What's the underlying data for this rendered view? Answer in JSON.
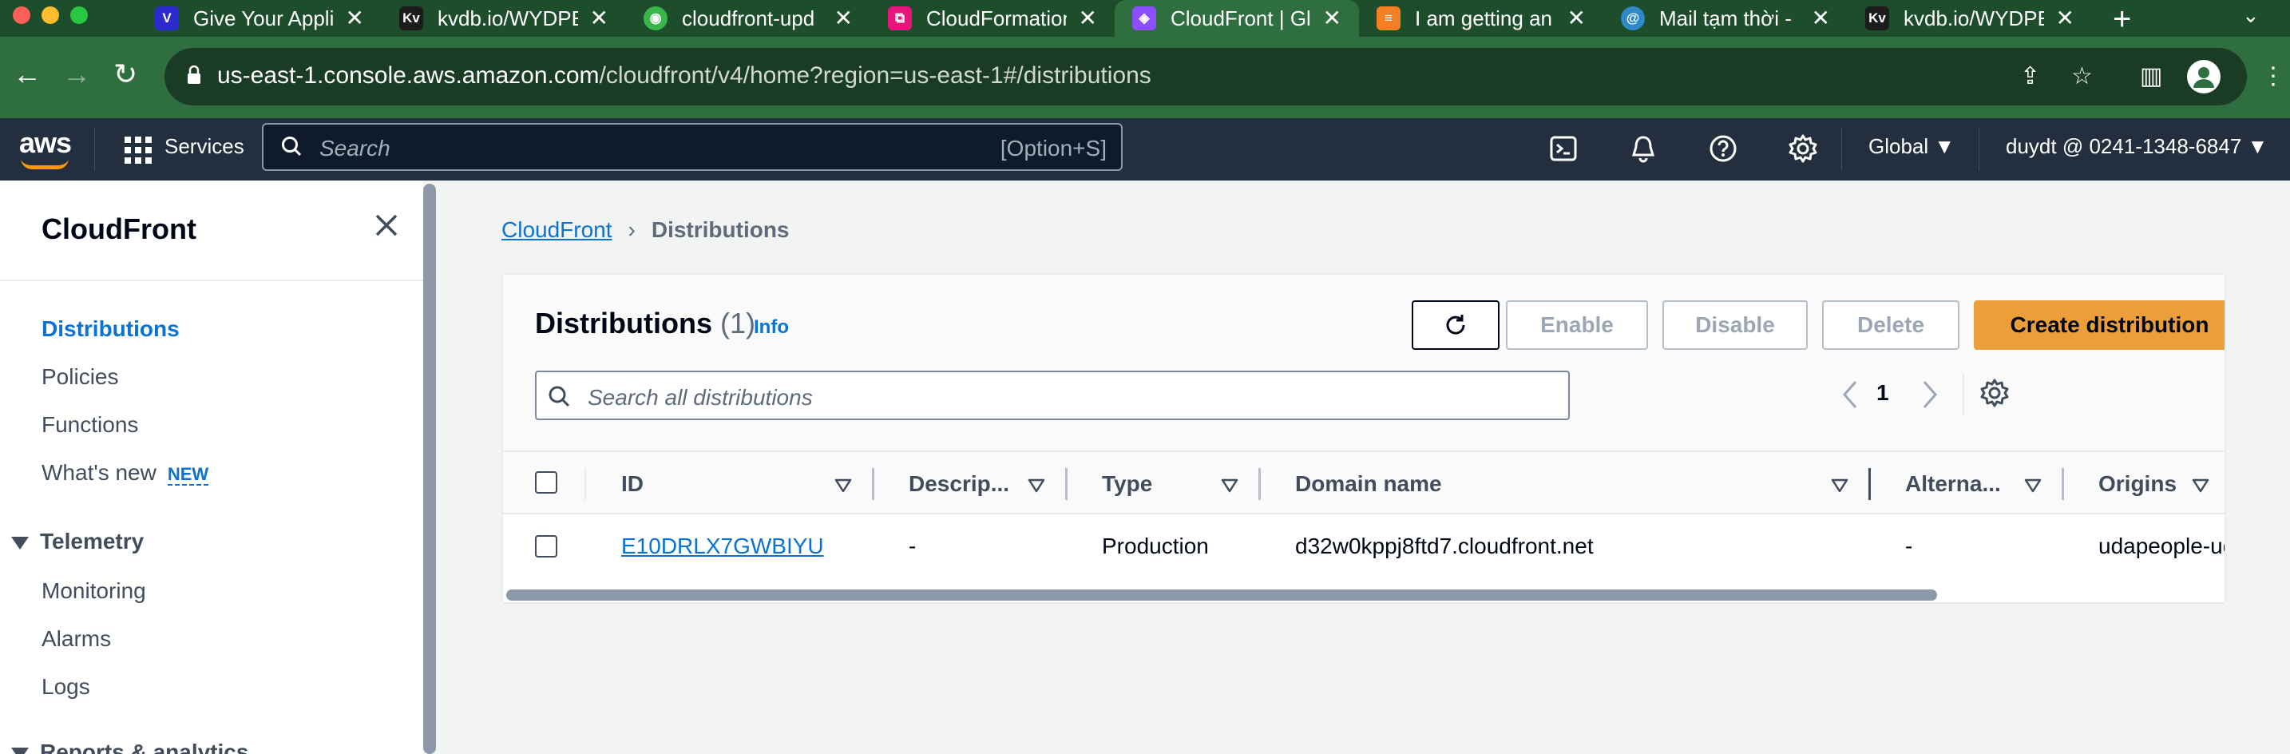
{
  "browser": {
    "tabs": [
      {
        "title": "Give Your Appli",
        "favicon_color": "#2a2ad0"
      },
      {
        "title": "kvdb.io/WYDPE",
        "favicon_color": "#1c1c1c"
      },
      {
        "title": "cloudfront-upd",
        "favicon_color": "#3ab54a"
      },
      {
        "title": "CloudFormation",
        "favicon_color": "#e7157b"
      },
      {
        "title": "CloudFront | Gl",
        "favicon_color": "#8c4fff",
        "active": true
      },
      {
        "title": "I am getting an",
        "favicon_color": "#f48024"
      },
      {
        "title": "Mail tạm thời -",
        "favicon_color": "#2f88c8"
      },
      {
        "title": "kvdb.io/WYDPE",
        "favicon_color": "#1c1c1c"
      }
    ],
    "favicon_glyphs": [
      "V",
      "Kv",
      "◉",
      "⧉",
      "◈",
      "≡",
      "@",
      "Kv"
    ],
    "url_host": "us-east-1.console.aws.amazon.com",
    "url_path": "/cloudfront/v4/home?region=us-east-1#/distributions"
  },
  "aws_nav": {
    "logo": "aws",
    "services_label": "Services",
    "search_placeholder": "Search",
    "search_shortcut": "[Option+S]",
    "region": "Global ▼",
    "account": "duydt @ 0241-1348-6847 ▼",
    "icons": [
      "cloudshell-icon",
      "notifications-icon",
      "help-icon",
      "settings-icon"
    ]
  },
  "sidebar": {
    "title": "CloudFront",
    "items": [
      {
        "label": "Distributions",
        "active": true
      },
      {
        "label": "Policies"
      },
      {
        "label": "Functions"
      },
      {
        "label": "What's new",
        "badge": "NEW"
      }
    ],
    "sections": [
      {
        "title": "Telemetry",
        "items": [
          "Monitoring",
          "Alarms",
          "Logs"
        ]
      },
      {
        "title": "Reports & analytics"
      }
    ]
  },
  "breadcrumb": {
    "root": "CloudFront",
    "current": "Distributions"
  },
  "distributions": {
    "title": "Distributions",
    "count": "(1)",
    "info": "Info",
    "buttons": {
      "enable": "Enable",
      "disable": "Disable",
      "delete": "Delete",
      "create": "Create distribution"
    },
    "search_placeholder": "Search all distributions",
    "page": "1",
    "columns": [
      "ID",
      "Descrip...",
      "Type",
      "Domain name",
      "Alterna...",
      "Origins"
    ],
    "rows": [
      {
        "id": "E10DRLX7GWBIYU",
        "description": "-",
        "type": "Production",
        "domain": "d32w0kppj8ftd7.cloudfront.net",
        "alternate": "-",
        "origins": "udapeople-udap"
      }
    ]
  },
  "colors": {
    "browser_frame": "#2f6e3e",
    "aws_nav": "#232f3e",
    "link": "#0972d3",
    "primary_button": "#ec9e3a",
    "status_deployed": "#037f0c"
  }
}
